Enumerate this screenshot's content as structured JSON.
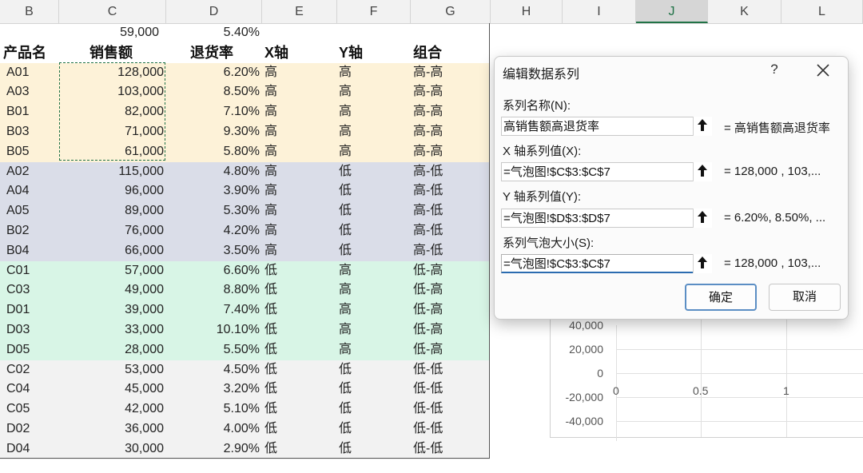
{
  "column_headers": [
    "B",
    "C",
    "D",
    "E",
    "F",
    "G",
    "H",
    "I",
    "J",
    "K",
    "L"
  ],
  "summary_row": {
    "sales": "59,000",
    "return_rate": "5.40%"
  },
  "table_header": {
    "product": "产品名",
    "sales": "销售额",
    "return_rate": "退货率",
    "x_axis": "X轴",
    "y_axis": "Y轴",
    "combo": "组合"
  },
  "rows": [
    {
      "product": "A01",
      "sales": "128,000",
      "rate": "6.20%",
      "x": "高",
      "y": "高",
      "combo": "高-高",
      "group": "yellow"
    },
    {
      "product": "A03",
      "sales": "103,000",
      "rate": "8.50%",
      "x": "高",
      "y": "高",
      "combo": "高-高",
      "group": "yellow"
    },
    {
      "product": "B01",
      "sales": "82,000",
      "rate": "7.10%",
      "x": "高",
      "y": "高",
      "combo": "高-高",
      "group": "yellow"
    },
    {
      "product": "B03",
      "sales": "71,000",
      "rate": "9.30%",
      "x": "高",
      "y": "高",
      "combo": "高-高",
      "group": "yellow"
    },
    {
      "product": "B05",
      "sales": "61,000",
      "rate": "5.80%",
      "x": "高",
      "y": "高",
      "combo": "高-高",
      "group": "yellow"
    },
    {
      "product": "A02",
      "sales": "115,000",
      "rate": "4.80%",
      "x": "高",
      "y": "低",
      "combo": "高-低",
      "group": "blue"
    },
    {
      "product": "A04",
      "sales": "96,000",
      "rate": "3.90%",
      "x": "高",
      "y": "低",
      "combo": "高-低",
      "group": "blue"
    },
    {
      "product": "A05",
      "sales": "89,000",
      "rate": "5.30%",
      "x": "高",
      "y": "低",
      "combo": "高-低",
      "group": "blue"
    },
    {
      "product": "B02",
      "sales": "76,000",
      "rate": "4.20%",
      "x": "高",
      "y": "低",
      "combo": "高-低",
      "group": "blue"
    },
    {
      "product": "B04",
      "sales": "66,000",
      "rate": "3.50%",
      "x": "高",
      "y": "低",
      "combo": "高-低",
      "group": "blue"
    },
    {
      "product": "C01",
      "sales": "57,000",
      "rate": "6.60%",
      "x": "低",
      "y": "高",
      "combo": "低-高",
      "group": "green"
    },
    {
      "product": "C03",
      "sales": "49,000",
      "rate": "8.80%",
      "x": "低",
      "y": "高",
      "combo": "低-高",
      "group": "green"
    },
    {
      "product": "D01",
      "sales": "39,000",
      "rate": "7.40%",
      "x": "低",
      "y": "高",
      "combo": "低-高",
      "group": "green"
    },
    {
      "product": "D03",
      "sales": "33,000",
      "rate": "10.10%",
      "x": "低",
      "y": "高",
      "combo": "低-高",
      "group": "green"
    },
    {
      "product": "D05",
      "sales": "28,000",
      "rate": "5.50%",
      "x": "低",
      "y": "高",
      "combo": "低-高",
      "group": "green"
    },
    {
      "product": "C02",
      "sales": "53,000",
      "rate": "4.50%",
      "x": "低",
      "y": "低",
      "combo": "低-低",
      "group": "gray"
    },
    {
      "product": "C04",
      "sales": "45,000",
      "rate": "3.20%",
      "x": "低",
      "y": "低",
      "combo": "低-低",
      "group": "gray"
    },
    {
      "product": "C05",
      "sales": "42,000",
      "rate": "5.10%",
      "x": "低",
      "y": "低",
      "combo": "低-低",
      "group": "gray"
    },
    {
      "product": "D02",
      "sales": "36,000",
      "rate": "4.00%",
      "x": "低",
      "y": "低",
      "combo": "低-低",
      "group": "gray"
    },
    {
      "product": "D04",
      "sales": "30,000",
      "rate": "2.90%",
      "x": "低",
      "y": "低",
      "combo": "低-低",
      "group": "gray"
    }
  ],
  "chart": {
    "y_ticks": [
      "40,000",
      "20,000",
      "0",
      "-20,000",
      "-40,000"
    ],
    "x_ticks": [
      "0",
      "0.5",
      "1"
    ]
  },
  "dialog": {
    "title": "编辑数据系列",
    "help": "?",
    "series_name_label": "系列名称(N):",
    "series_name_value": "高销售额高退货率",
    "series_name_preview": "= 高销售额高退货率",
    "x_values_label": "X 轴系列值(X):",
    "x_values_value": "=气泡图!$C$3:$C$7",
    "x_values_preview": "= 128,000 , 103,...",
    "y_values_label": "Y 轴系列值(Y):",
    "y_values_value": "=气泡图!$D$3:$D$7",
    "y_values_preview": "= 6.20%, 8.50%, ...",
    "bubble_size_label": "系列气泡大小(S):",
    "bubble_size_value": "=气泡图!$C$3:$C$7",
    "bubble_size_preview": "= 128,000 , 103,...",
    "ok": "确定",
    "cancel": "取消"
  },
  "colors": {
    "yellow": "#fdf2d8",
    "blue": "#dadde8",
    "green": "#d8f5e6",
    "gray": "#f2f2f2",
    "selection": "#1e7145",
    "accent": "#5b8ec4"
  }
}
